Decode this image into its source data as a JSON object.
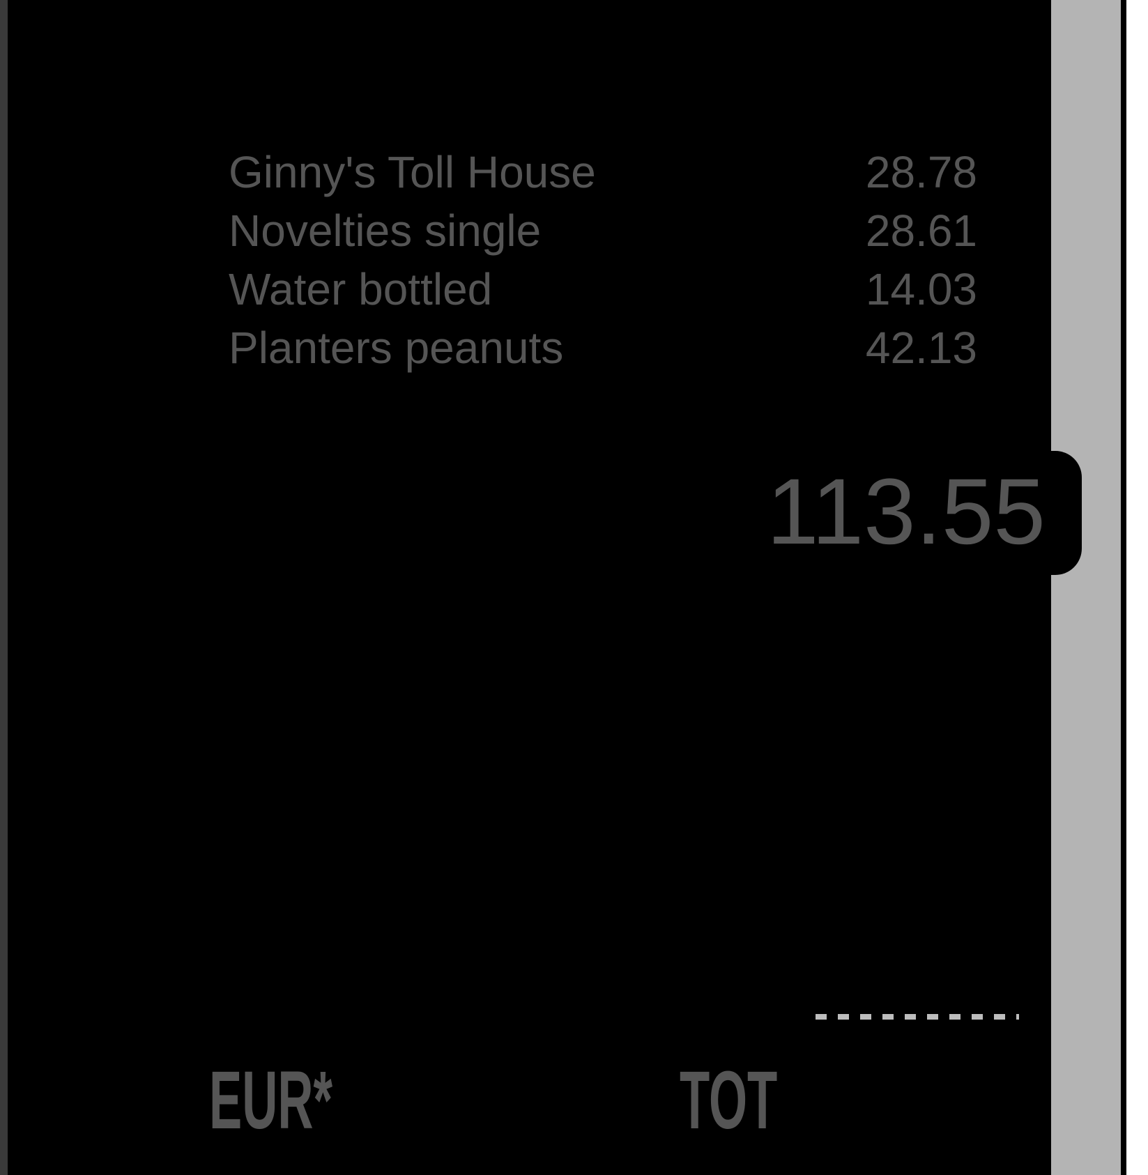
{
  "receipt": {
    "items": [
      {
        "name": "Ginny's Toll House",
        "price": "28.78"
      },
      {
        "name": "Novelties single",
        "price": "28.61"
      },
      {
        "name": "Water bottled",
        "price": "14.03"
      },
      {
        "name": "Planters peanuts",
        "price": "42.13"
      }
    ],
    "total_amount": "113.55",
    "currency_label": "EUR*",
    "total_label": "TOT"
  },
  "colors": {
    "background": "#000000",
    "text": "#555555",
    "paper_edge": "#b4b4b4"
  }
}
